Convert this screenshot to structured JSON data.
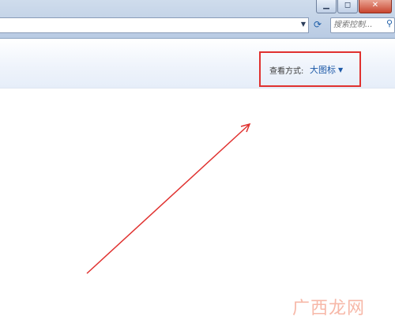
{
  "window": {
    "controls": [
      "minimize",
      "maximize",
      "close"
    ]
  },
  "search": {
    "placeholder": "搜索控制..."
  },
  "view": {
    "label": "查看方式:",
    "value": "大图标"
  },
  "watermark": "广西龙网",
  "colors": {
    "annotation": "#e0312f",
    "link": "#1e5aa8"
  },
  "icons": [
    "chevron-down-icon",
    "refresh-icon",
    "search-icon",
    "arrow-annotation"
  ]
}
